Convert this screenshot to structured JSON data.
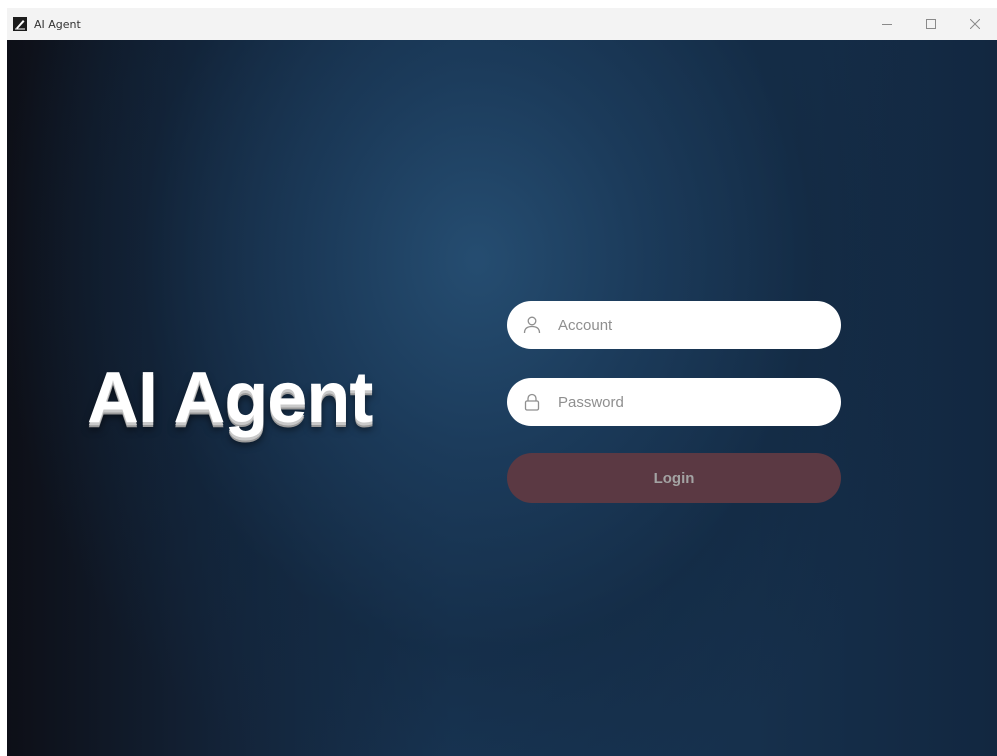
{
  "window": {
    "title": "AI Agent",
    "icons": {
      "app": "app-logo-icon",
      "minimize": "minimize-icon",
      "maximize": "maximize-icon",
      "close": "close-icon"
    }
  },
  "login": {
    "brand_title": "AI Agent",
    "account": {
      "placeholder": "Account",
      "value": "",
      "icon": "user-icon"
    },
    "password": {
      "placeholder": "Password",
      "value": "",
      "icon": "lock-icon"
    },
    "submit_label": "Login"
  },
  "colors": {
    "background_dark": "#0d0f17",
    "background_blue": "#183554",
    "login_button": "#5b3943",
    "login_button_text": "#a3a3a3",
    "field_background": "#ffffff",
    "placeholder_text": "#8f8f8f"
  }
}
